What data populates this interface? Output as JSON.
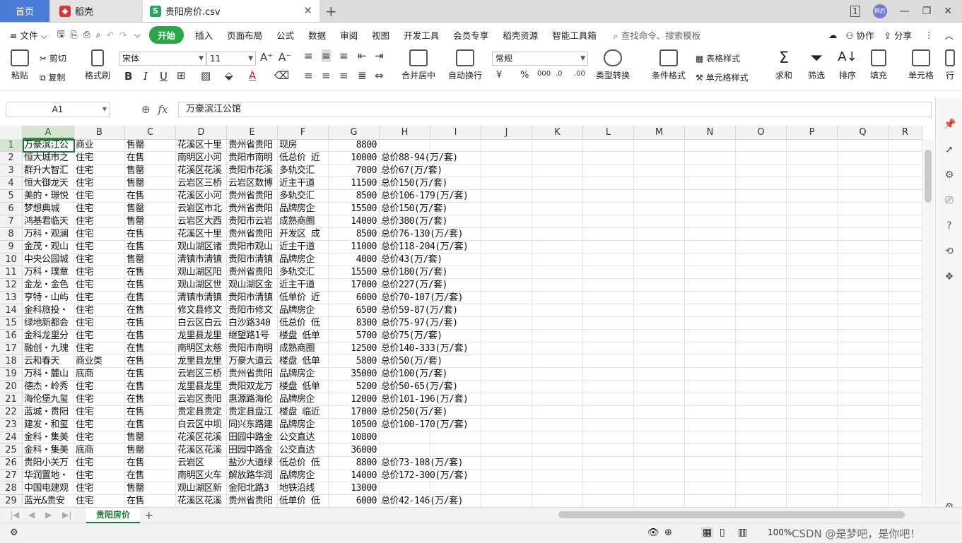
{
  "tabs": {
    "home": "首页",
    "daoke": "稻壳",
    "file": "贵阳房价.csv",
    "avatar": "稍后"
  },
  "menu": {
    "file": "文件",
    "items": [
      "开始",
      "插入",
      "页面布局",
      "公式",
      "数据",
      "审阅",
      "视图",
      "开发工具",
      "会员专享",
      "稻壳资源",
      "智能工具箱"
    ],
    "search": "查找命令、搜索模板",
    "collab": "协作",
    "share": "分享"
  },
  "ribbon": {
    "paste": "粘贴",
    "cut": "剪切",
    "copy": "复制",
    "format_painter": "格式刷",
    "font_name": "宋体",
    "font_size": "11",
    "merge_center": "合并居中",
    "wrap": "自动换行",
    "number_format": "常规",
    "type_convert": "类型转换",
    "cond_format": "条件格式",
    "table_style": "表格样式",
    "cell_style": "单元格样式",
    "sum": "求和",
    "filter": "筛选",
    "sort": "排序",
    "fill": "填充",
    "cell": "单元格",
    "row_col": "行"
  },
  "formula_bar": {
    "name_box": "A1",
    "fx": "fx",
    "content": "万豪滨江公馆"
  },
  "columns": [
    "A",
    "B",
    "C",
    "D",
    "E",
    "F",
    "G",
    "H",
    "I",
    "J",
    "K",
    "L",
    "M",
    "N",
    "O",
    "P",
    "Q",
    "R"
  ],
  "rows": [
    {
      "n": "1",
      "a": "万豪滨江公",
      "b": "商业",
      "c": "售罄",
      "d": "花溪区十里",
      "e": "贵州省贵阳",
      "f": "现房",
      "g": "8800",
      "h": ""
    },
    {
      "n": "2",
      "a": "恒大城市之",
      "b": "住宅",
      "c": "在售",
      "d": "南明区小河",
      "e": "贵阳市南明",
      "f": "低总价 近",
      "g": "10000",
      "h": "总价88-94(万/套)"
    },
    {
      "n": "3",
      "a": "群升大智汇",
      "b": "住宅",
      "c": "售罄",
      "d": "花溪区花溪",
      "e": "贵阳市花溪",
      "f": "多轨交汇",
      "g": "7000",
      "h": "总价67(万/套)"
    },
    {
      "n": "4",
      "a": "恒大御龙天",
      "b": "住宅",
      "c": "售罄",
      "d": "云岩区三桥",
      "e": "云岩区数博",
      "f": "近主干道",
      "g": "11500",
      "h": "总价150(万/套)"
    },
    {
      "n": "5",
      "a": "美的・璟悦",
      "b": "住宅",
      "c": "在售",
      "d": "花溪区小河",
      "e": "贵州省贵阳",
      "f": "多轨交汇",
      "g": "8500",
      "h": "总价106-179(万/套)"
    },
    {
      "n": "6",
      "a": "梦想典城",
      "b": "住宅",
      "c": "售罄",
      "d": "云岩区市北",
      "e": "贵州省贵阳",
      "f": "品牌房企",
      "g": "15500",
      "h": "总价150(万/套)"
    },
    {
      "n": "7",
      "a": "鸿基君临天",
      "b": "住宅",
      "c": "售罄",
      "d": "云岩区大西",
      "e": "贵阳市云岩",
      "f": "成熟商圈",
      "g": "14000",
      "h": "总价380(万/套)"
    },
    {
      "n": "8",
      "a": "万科・观澜",
      "b": "住宅",
      "c": "在售",
      "d": "花溪区十里",
      "e": "贵州省贵阳",
      "f": "开发区 成",
      "g": "8500",
      "h": "总价76-130(万/套)"
    },
    {
      "n": "9",
      "a": "金茂・观山",
      "b": "住宅",
      "c": "在售",
      "d": "观山湖区诸",
      "e": "贵阳市观山",
      "f": "近主干道",
      "g": "11000",
      "h": "总价118-204(万/套)"
    },
    {
      "n": "10",
      "a": "中央公园城",
      "b": "住宅",
      "c": "售罄",
      "d": "清镇市清镇",
      "e": "贵阳市清镇",
      "f": "品牌房企",
      "g": "4000",
      "h": "总价43(万/套)"
    },
    {
      "n": "11",
      "a": "万科・璞章",
      "b": "住宅",
      "c": "在售",
      "d": "观山湖区阳",
      "e": "贵州省贵阳",
      "f": "多轨交汇",
      "g": "15500",
      "h": "总价180(万/套)"
    },
    {
      "n": "12",
      "a": "金龙・金色",
      "b": "住宅",
      "c": "在售",
      "d": "观山湖区世",
      "e": "观山湖区金",
      "f": "近主干道",
      "g": "17000",
      "h": "总价227(万/套)"
    },
    {
      "n": "13",
      "a": "亨特・山屿",
      "b": "住宅",
      "c": "在售",
      "d": "清镇市清镇",
      "e": "贵阳市清镇",
      "f": "低单价 近",
      "g": "6000",
      "h": "总价70-107(万/套)"
    },
    {
      "n": "14",
      "a": "金科旅投・",
      "b": "住宅",
      "c": "在售",
      "d": "修文县修文",
      "e": "贵阳市修文",
      "f": "品牌房企",
      "g": "6500",
      "h": "总价59-87(万/套)"
    },
    {
      "n": "15",
      "a": "绿地新都会",
      "b": "住宅",
      "c": "在售",
      "d": "白云区白云",
      "e": "白沙路340",
      "f": "低总价 低",
      "g": "8300",
      "h": "总价75-97(万/套)"
    },
    {
      "n": "16",
      "a": "金科龙里分",
      "b": "住宅",
      "c": "在售",
      "d": "龙里县龙里",
      "e": "继望路1号",
      "f": "楼盘 低单",
      "g": "5700",
      "h": "总价75(万/套)"
    },
    {
      "n": "17",
      "a": "融创・九瑰",
      "b": "住宅",
      "c": "在售",
      "d": "南明区太慈",
      "e": "贵阳市南明",
      "f": "成熟商圈",
      "g": "12500",
      "h": "总价140-333(万/套)"
    },
    {
      "n": "18",
      "a": "云和春天",
      "b": "商业类",
      "c": "在售",
      "d": "龙里县龙里",
      "e": "万豪大道云",
      "f": "楼盘 低单",
      "g": "5800",
      "h": "总价50(万/套)"
    },
    {
      "n": "19",
      "a": "万科・麓山",
      "b": "底商",
      "c": "在售",
      "d": "云岩区三桥",
      "e": "贵州省贵阳",
      "f": "品牌房企",
      "g": "35000",
      "h": "总价100(万/套)"
    },
    {
      "n": "20",
      "a": "德杰・岭秀",
      "b": "住宅",
      "c": "在售",
      "d": "龙里县龙里",
      "e": "贵阳双龙万",
      "f": "楼盘 低单",
      "g": "5200",
      "h": "总价50-65(万/套)"
    },
    {
      "n": "21",
      "a": "海伦堡九玺",
      "b": "住宅",
      "c": "在售",
      "d": "云岩区贵阳",
      "e": "惠源路海伦",
      "f": "品牌房企",
      "g": "12000",
      "h": "总价101-196(万/套)"
    },
    {
      "n": "22",
      "a": "蓝城・贵阳",
      "b": "住宅",
      "c": "在售",
      "d": "贵定县贵定",
      "e": "贵定县盘江",
      "f": "楼盘 临近",
      "g": "17000",
      "h": "总价250(万/套)"
    },
    {
      "n": "23",
      "a": "建发・和玺",
      "b": "住宅",
      "c": "在售",
      "d": "白云区中坝",
      "e": "同兴东路建",
      "f": "品牌房企",
      "g": "10500",
      "h": "总价100-170(万/套)"
    },
    {
      "n": "24",
      "a": "金科・集美",
      "b": "住宅",
      "c": "售罄",
      "d": "花溪区花溪",
      "e": "田园中路金",
      "f": "公交直达",
      "g": "10800",
      "h": ""
    },
    {
      "n": "25",
      "a": "金科・集美",
      "b": "底商",
      "c": "售罄",
      "d": "花溪区花溪",
      "e": "田园中路金",
      "f": "公交直达",
      "g": "36000",
      "h": ""
    },
    {
      "n": "26",
      "a": "贵阳小关万",
      "b": "住宅",
      "c": "在售",
      "d": "云岩区",
      "e": "盐沙大道绿",
      "f": "低总价 低",
      "g": "8800",
      "h": "总价73-108(万/套)"
    },
    {
      "n": "27",
      "a": "华润置地・",
      "b": "住宅",
      "c": "在售",
      "d": "南明区火车",
      "e": "解放路华润",
      "f": "品牌房企",
      "g": "14000",
      "h": "总价172-300(万/套)"
    },
    {
      "n": "28",
      "a": "中国电建观",
      "b": "住宅",
      "c": "售罄",
      "d": "观山湖区新",
      "e": "金阳北路3",
      "f": "地铁沿线",
      "g": "13000",
      "h": ""
    },
    {
      "n": "29",
      "a": "蓝光&贵安",
      "b": "住宅",
      "c": "在售",
      "d": "花溪区花溪",
      "e": "贵州省贵阳",
      "f": "低单价 低",
      "g": "6000",
      "h": "总价42-146(万/套)"
    }
  ],
  "sheet_tab": "贵阳房价",
  "status": {
    "zoom": "100%",
    "watermark": "CSDN @是梦吧，是你吧！"
  },
  "colors": {
    "accent_green": "#28a745",
    "home_tab_blue": "#4a7bd6"
  }
}
